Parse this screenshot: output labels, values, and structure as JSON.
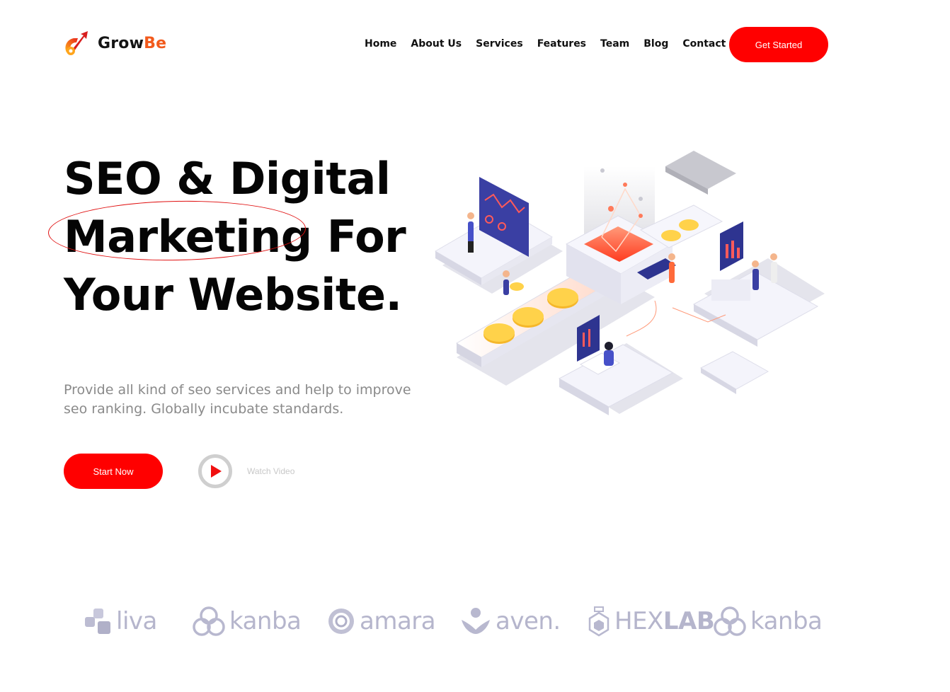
{
  "header": {
    "logo": {
      "text_main": "Grow",
      "text_accent": "Be",
      "icon": "rocket-arrow-icon"
    },
    "nav": [
      {
        "label": "Home"
      },
      {
        "label": "About Us"
      },
      {
        "label": "Services"
      },
      {
        "label": "Features"
      },
      {
        "label": "Team"
      },
      {
        "label": "Blog"
      },
      {
        "label": "Contact"
      }
    ],
    "cta_label": "Get Started"
  },
  "hero": {
    "title_line1": "SEO & Digital",
    "title_highlight": "Marketing",
    "title_line2_rest": " For",
    "title_line3": "Your Website.",
    "description": "Provide all kind of seo services and help to improve seo ranking. Globally incubate standards.",
    "primary_button": "Start Now",
    "video_label": "Watch Video",
    "illustration_icon": "isometric-seo-illustration"
  },
  "brands": [
    {
      "name": "liva",
      "icon": "liva-logo-icon"
    },
    {
      "name": "kanba",
      "icon": "kanba-logo-icon"
    },
    {
      "name": "amara",
      "icon": "amara-logo-icon"
    },
    {
      "name": "aven.",
      "icon": "aven-logo-icon"
    },
    {
      "name_light": "HEX",
      "name_bold": "LAB",
      "icon": "hexlab-logo-icon"
    },
    {
      "name": "kanba",
      "icon": "kanba-logo-icon"
    }
  ],
  "colors": {
    "accent": "#ff0000",
    "logo_accent": "#f25a1c",
    "brand_gray": "#b5b5cc",
    "text_muted": "#8a8a8a"
  }
}
